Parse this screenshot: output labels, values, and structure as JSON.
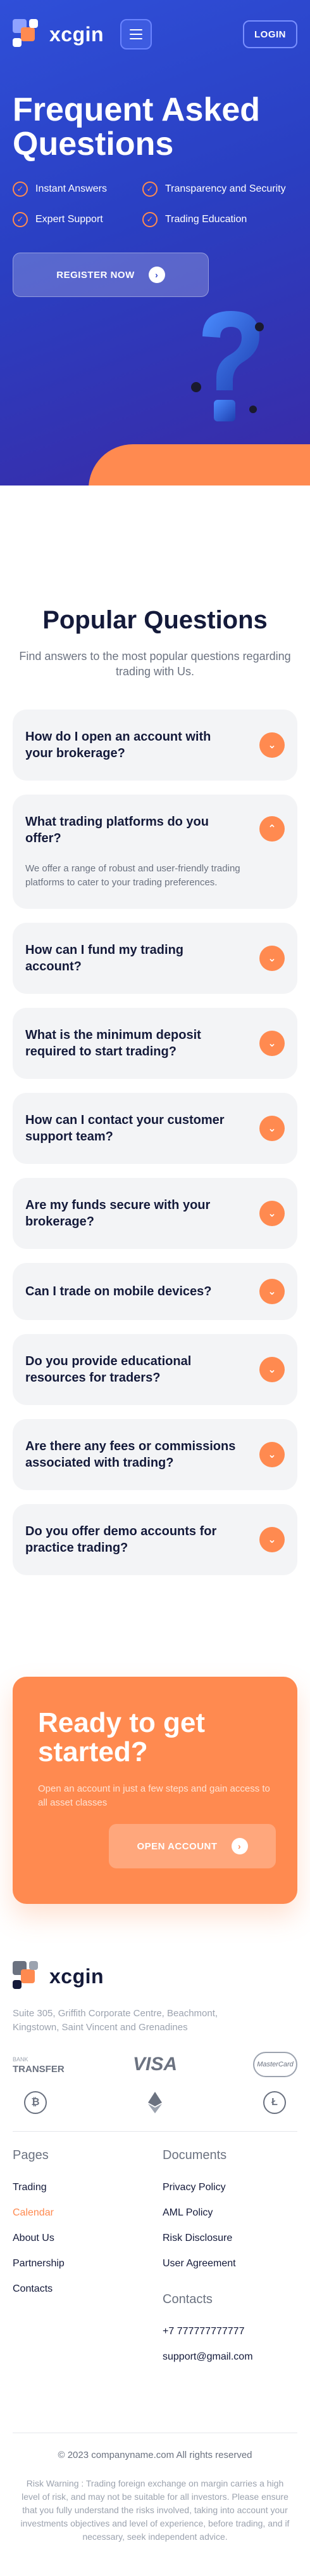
{
  "header": {
    "logo_text": "xcgin",
    "login_label": "LOGIN"
  },
  "hero": {
    "title": "Frequent Asked Questions",
    "features": [
      "Instant Answers",
      "Transparency and Security",
      "Expert Support",
      "Trading Education"
    ],
    "register_label": "REGISTER NOW",
    "colors": {
      "accent": "#ff8a50",
      "primary": "#2f4fd8"
    }
  },
  "faq": {
    "title": "Popular Questions",
    "subtitle": "Find answers to the most popular questions regarding trading with Us.",
    "items": [
      {
        "question": "How do I open an account with your brokerage?",
        "answer": "",
        "open": false
      },
      {
        "question": "What trading platforms do you offer?",
        "answer": "We offer a range of robust and user-friendly trading platforms to cater to your trading preferences.",
        "open": true
      },
      {
        "question": "How can I fund my trading account?",
        "answer": "",
        "open": false
      },
      {
        "question": "What is the minimum deposit required to start trading?",
        "answer": "",
        "open": false
      },
      {
        "question": "How can I contact your customer support team?",
        "answer": "",
        "open": false
      },
      {
        "question": "Are my funds secure with your brokerage?",
        "answer": "",
        "open": false
      },
      {
        "question": "Can I trade on mobile devices?",
        "answer": "",
        "open": false
      },
      {
        "question": "Do you provide educational resources for traders?",
        "answer": "",
        "open": false
      },
      {
        "question": "Are there any fees or commissions associated with trading?",
        "answer": "",
        "open": false
      },
      {
        "question": "Do you offer demo accounts for practice trading?",
        "answer": "",
        "open": false
      }
    ]
  },
  "cta": {
    "title": "Ready to get started?",
    "text": "Open an account in just a few steps and gain access to all asset classes",
    "button_label": "OPEN ACCOUNT"
  },
  "footer": {
    "logo_text": "xcgin",
    "address": "Suite 305, Griffith Corporate Centre, Beachmont, Kingstown, Saint Vincent and Grenadines",
    "payments": {
      "bank_small": "BANK",
      "bank_big": "TRANSFER",
      "visa": "VISA",
      "mastercard": "MasterCard",
      "icons": [
        "bitcoin-icon",
        "ethereum-icon",
        "litecoin-icon"
      ]
    },
    "pages_title": "Pages",
    "pages": [
      {
        "label": "Trading",
        "active": false
      },
      {
        "label": "Calendar",
        "active": true
      },
      {
        "label": "About Us",
        "active": false
      },
      {
        "label": "Partnership",
        "active": false
      },
      {
        "label": "Contacts",
        "active": false
      }
    ],
    "documents_title": "Documents",
    "documents": [
      "Privacy Policy",
      "AML Policy",
      "Risk Disclosure",
      "User Agreement"
    ],
    "contacts_title": "Contacts",
    "phone": "+7 777777777777",
    "email": "support@gmail.com",
    "copyright": "© 2023 companyname.com All rights reserved",
    "risk_warning": "Risk Warning : Trading foreign exchange on margin carries a high level of risk, and may not be suitable for all investors. Please ensure that you fully understand the risks involved, taking into account your investments objectives and level of experience, before trading, and if necessary, seek independent advice."
  }
}
